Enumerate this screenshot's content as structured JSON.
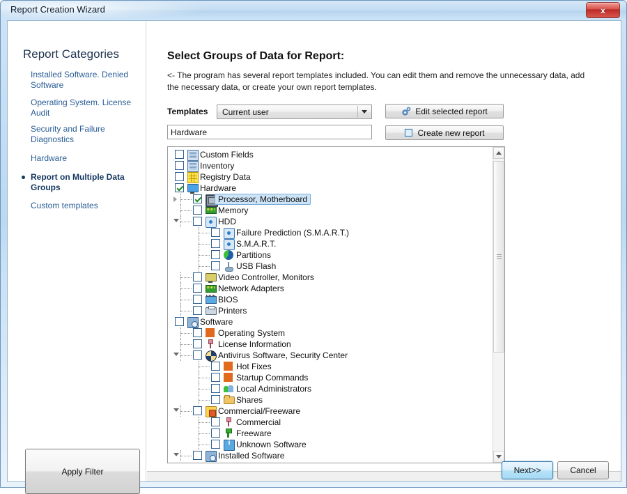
{
  "window": {
    "title": "Report Creation Wizard",
    "close_label": "x"
  },
  "sidebar": {
    "title": "Report Categories",
    "items": [
      {
        "label": "Installed Software. Denied Software",
        "active": false
      },
      {
        "label": "Operating System. License Audit",
        "active": false
      },
      {
        "label": "Security and Failure Diagnostics",
        "active": false
      },
      {
        "label": "Hardware",
        "active": false
      },
      {
        "label": "Report on Multiple Data Groups",
        "active": true
      },
      {
        "label": "Custom templates",
        "active": false
      }
    ],
    "apply_filter_label": "Apply Filter"
  },
  "main": {
    "title": "Select Groups of Data for Report:",
    "description": "<- The program has several report templates included. You can edit them and remove the unnecessary data, add the necessary data, or create your own report templates.",
    "templates_label": "Templates",
    "templates_value": "Current user",
    "report_name_value": "Hardware",
    "report_name_placeholder": "",
    "edit_button_label": "Edit selected report",
    "create_button_label": "Create new report"
  },
  "tree": [
    {
      "label": "Custom Fields",
      "level": 0,
      "checked": false,
      "icon": "document-icon",
      "expander": "none"
    },
    {
      "label": "Inventory",
      "level": 0,
      "checked": false,
      "icon": "document-icon",
      "expander": "none"
    },
    {
      "label": "Registry Data",
      "level": 0,
      "checked": false,
      "icon": "grid-icon",
      "expander": "none"
    },
    {
      "label": "Hardware",
      "level": 0,
      "checked": true,
      "icon": "monitor-icon",
      "expander": "none"
    },
    {
      "label": "Processor, Motherboard",
      "level": 1,
      "checked": true,
      "icon": "cpu-icon",
      "expander": "collapsed",
      "selected": true
    },
    {
      "label": "Memory",
      "level": 1,
      "checked": false,
      "icon": "memory-icon",
      "expander": "none"
    },
    {
      "label": "HDD",
      "level": 1,
      "checked": false,
      "icon": "hdd-icon",
      "expander": "expanded"
    },
    {
      "label": "Failure Prediction (S.M.A.R.T.)",
      "level": 2,
      "checked": false,
      "icon": "hdd-icon",
      "expander": "none"
    },
    {
      "label": "S.M.A.R.T.",
      "level": 2,
      "checked": false,
      "icon": "hdd-icon",
      "expander": "none"
    },
    {
      "label": "Partitions",
      "level": 2,
      "checked": false,
      "icon": "pie-icon",
      "expander": "none"
    },
    {
      "label": "USB Flash",
      "level": 2,
      "checked": false,
      "icon": "usb-icon",
      "expander": "none"
    },
    {
      "label": "Video Controller, Monitors",
      "level": 1,
      "checked": false,
      "icon": "video-icon",
      "expander": "none"
    },
    {
      "label": "Network Adapters",
      "level": 1,
      "checked": false,
      "icon": "network-icon",
      "expander": "none"
    },
    {
      "label": "BIOS",
      "level": 1,
      "checked": false,
      "icon": "bios-icon",
      "expander": "none"
    },
    {
      "label": "Printers",
      "level": 1,
      "checked": false,
      "icon": "printer-icon",
      "expander": "none"
    },
    {
      "label": "Software",
      "level": 0,
      "checked": false,
      "icon": "software-icon",
      "expander": "none"
    },
    {
      "label": "Operating System",
      "level": 1,
      "checked": false,
      "icon": "windows-icon",
      "expander": "none"
    },
    {
      "label": "License Information",
      "level": 1,
      "checked": false,
      "icon": "key-icon",
      "expander": "none"
    },
    {
      "label": "Antivirus Software, Security Center",
      "level": 1,
      "checked": false,
      "icon": "shield-icon",
      "expander": "expanded"
    },
    {
      "label": "Hot Fixes",
      "level": 2,
      "checked": false,
      "icon": "windows-icon",
      "expander": "none"
    },
    {
      "label": "Startup Commands",
      "level": 2,
      "checked": false,
      "icon": "windows-icon",
      "expander": "none"
    },
    {
      "label": "Local Administrators",
      "level": 2,
      "checked": false,
      "icon": "users-icon",
      "expander": "none"
    },
    {
      "label": "Shares",
      "level": 2,
      "checked": false,
      "icon": "folder-icon",
      "expander": "none"
    },
    {
      "label": "Commercial/Freeware",
      "level": 1,
      "checked": false,
      "icon": "commercial-icon",
      "expander": "expanded"
    },
    {
      "label": "Commercial",
      "level": 2,
      "checked": false,
      "icon": "key-icon",
      "expander": "none"
    },
    {
      "label": "Freeware",
      "level": 2,
      "checked": false,
      "icon": "key-green-icon",
      "expander": "none"
    },
    {
      "label": "Unknown Software",
      "level": 2,
      "checked": false,
      "icon": "info-icon",
      "expander": "none"
    },
    {
      "label": "Installed Software",
      "level": 1,
      "checked": false,
      "icon": "software-icon",
      "expander": "expanded"
    }
  ],
  "scrollbar": {
    "up_arrow": "scroll-up",
    "down_arrow": "scroll-down"
  },
  "footer": {
    "next_label": "Next>>",
    "cancel_label": "Cancel"
  },
  "colors": {
    "accent_blue": "#2a5d96",
    "selection": "#cde4f7",
    "title_gradient_top": "#d6e8f8",
    "close_red": "#bb2b26"
  }
}
